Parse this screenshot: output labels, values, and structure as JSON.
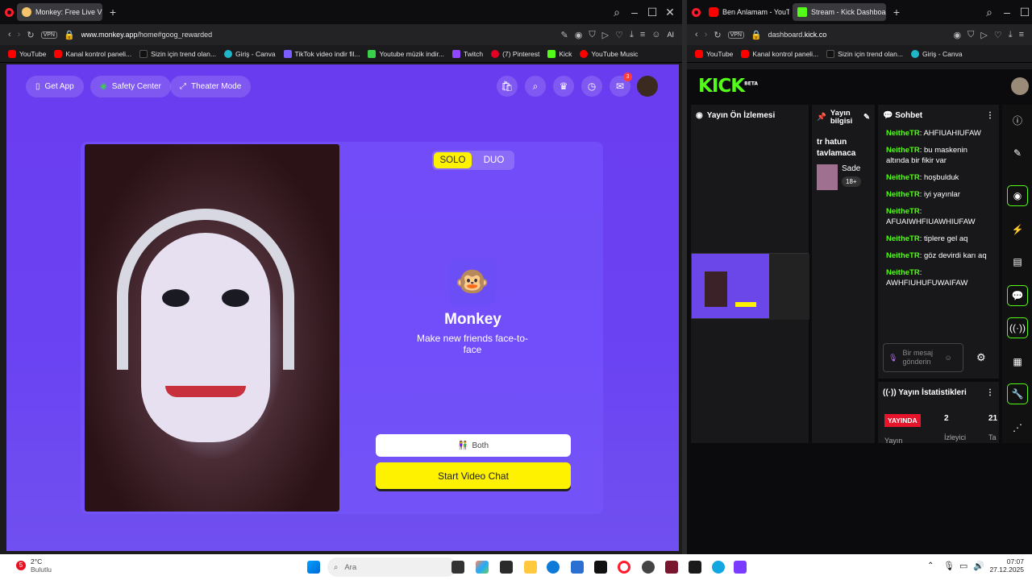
{
  "left_browser": {
    "tab_title": "Monkey: Free Live Video C",
    "url_base": "www.monkey.app",
    "url_path": "/home#goog_rewarded",
    "vpn": "VPN",
    "ai": "AI",
    "bookmarks": [
      "YouTube",
      "Kanal kontrol paneli...",
      "Sizin için trend olan...",
      "Giriş - Canva",
      "TikTok video indir fil...",
      "Youtube müzik indir...",
      "Twitch",
      "(7) Pinterest",
      "Kick",
      "YouTube Music"
    ]
  },
  "monkey": {
    "get_app": "Get App",
    "safety_center": "Safety Center",
    "theater_mode": "Theater Mode",
    "notif_count": "3",
    "solo": "SOLO",
    "duo": "DUO",
    "brand": "Monkey",
    "tagline": "Make new friends face-to-face",
    "both": "Both",
    "start": "Start Video Chat",
    "accent": "#fff200",
    "bg": "#6a3cf0"
  },
  "right_browser": {
    "tab1": "Ben Anlamam - YouTube",
    "tab2": "Stream - Kick Dashboard",
    "url_base": "dashboard.",
    "url_domain": "kick.co",
    "vpn": "VPN",
    "bookmarks": [
      "YouTube",
      "Kanal kontrol paneli...",
      "Sizin için trend olan...",
      "Giriş - Canva"
    ]
  },
  "kick": {
    "logo": "KICK",
    "beta": "BETA",
    "preview_title": "Yayın Ön İzlemesi",
    "info_title": "Yayın bilgisi",
    "stream_title": "tr hatun tavlamaca",
    "category": "Sade",
    "age": "18+",
    "chat_title": "Sohbet",
    "chat": [
      {
        "user": "NeitheTR",
        "msg": "AHFIUAHIUFAW"
      },
      {
        "user": "NeitheTR",
        "msg": "bu maskenin altında bir fikir var"
      },
      {
        "user": "NeitheTR",
        "msg": "hoşbulduk"
      },
      {
        "user": "NeitheTR",
        "msg": "iyi yayınlar"
      },
      {
        "user": "NeitheTR",
        "msg": "AFUAIWHFIUAWHIUFAW"
      },
      {
        "user": "NeitheTR",
        "msg": "tiplere gel aq"
      },
      {
        "user": "NeitheTR",
        "msg": "göz devirdi karı aq"
      },
      {
        "user": "NeitheTR",
        "msg": "AWHFIUHUFUWAIFAW"
      }
    ],
    "chat_placeholder": "Bir mesaj gönderin",
    "stats_title": "Yayın İstatistikleri",
    "live_badge": "YAYINDA",
    "stat1": "2",
    "stat1_label": "İzleyici",
    "stat2": "21",
    "stat_cut1": "Yayın",
    "stat_cut2": "Ta"
  },
  "taskbar": {
    "weather_temp": "2°C",
    "weather_desc": "Bulutlu",
    "weather_badge": "5",
    "search": "Ara",
    "time": "07:07",
    "date": "27.12.2025"
  }
}
